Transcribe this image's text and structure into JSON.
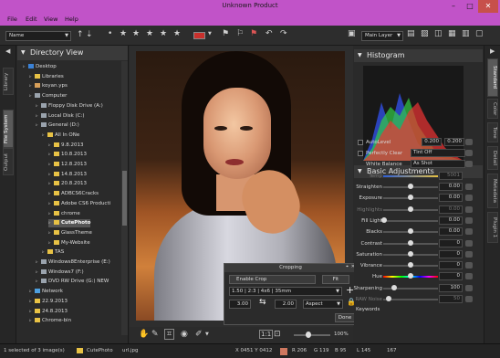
{
  "window": {
    "title": "Unknown Product"
  },
  "menu": {
    "file": "File",
    "edit": "Edit",
    "view": "View",
    "help": "Help"
  },
  "toolbar": {
    "sort": "Name",
    "layer": "Main Layer"
  },
  "left_tabs": {
    "library": "Library",
    "filesystem": "File System",
    "output": "Output"
  },
  "right_tabs": {
    "standard": "Standard",
    "color": "Color",
    "tone": "Tone",
    "detail": "Detail",
    "metadata": "Metadata",
    "plugin": "Plugin 1"
  },
  "directory": {
    "header": "Directory View",
    "items": [
      {
        "label": "Desktop"
      },
      {
        "label": "Libraries"
      },
      {
        "label": "koyan.yps"
      },
      {
        "label": "Computer"
      },
      {
        "label": "Floppy Disk Drive (A:)"
      },
      {
        "label": "Local Disk (C:)"
      },
      {
        "label": "General (D:)"
      },
      {
        "label": "All In ONe"
      },
      {
        "label": "9.8.2013"
      },
      {
        "label": "10.8.2013"
      },
      {
        "label": "12.8.2013"
      },
      {
        "label": "14.8.2013"
      },
      {
        "label": "20.8.2013"
      },
      {
        "label": "ADBCS6Cracks"
      },
      {
        "label": "Adobe CS6 Producti"
      },
      {
        "label": "chrome"
      },
      {
        "label": "CutePhoto"
      },
      {
        "label": "GlassTheme"
      },
      {
        "label": "My-Website"
      },
      {
        "label": "TAS"
      },
      {
        "label": "Windows8Enterprise (E:)"
      },
      {
        "label": "Windows7 (F:)"
      },
      {
        "label": "DVD RW Drive (G:) NEW"
      },
      {
        "label": "Network"
      },
      {
        "label": "22.9.2013"
      },
      {
        "label": "24.8.2013"
      },
      {
        "label": "Chrome-bin"
      }
    ]
  },
  "crop": {
    "title": "Cropping",
    "enable": "Enable Crop",
    "fit": "Fit",
    "ratio": "1.50 | 2:3 | 4x6 | 35mm",
    "w": "3.00",
    "h": "2.00",
    "mode": "Aspect",
    "done": "Done"
  },
  "histogram": {
    "title": "Histogram"
  },
  "adjust": {
    "title": "Basic Adjustments",
    "autolevel": {
      "label": "AutoLevel",
      "v1": "0.200",
      "v2": "0.200"
    },
    "perfectly_clear": {
      "label": "Perfectly Clear",
      "value": "Tint Off"
    },
    "white_balance": {
      "label": "White Balance",
      "value": "As Shot"
    },
    "temp": {
      "label": "Temp",
      "value": "5001"
    },
    "sliders": [
      {
        "label": "Straighten",
        "value": "0.00"
      },
      {
        "label": "Exposure",
        "value": "0.00"
      },
      {
        "label": "Highlights",
        "value": "0.00"
      },
      {
        "label": "Fill Light",
        "value": "0.00"
      },
      {
        "label": "Blacks",
        "value": "0.00"
      },
      {
        "label": "Contrast",
        "value": "0"
      },
      {
        "label": "Saturation",
        "value": "0"
      },
      {
        "label": "Vibrance",
        "value": "0"
      },
      {
        "label": "Hue",
        "value": "0"
      },
      {
        "label": "Sharpening",
        "value": "100"
      },
      {
        "label": "RAW Noise",
        "value": "50"
      }
    ],
    "keywords": "Keywords"
  },
  "bottom": {
    "zoom": "100%"
  },
  "status": {
    "selected": "1 selected of 3 image(s)",
    "folder": "CutePhoto",
    "file": "url.jpg",
    "coords": "X 0451 Y 0412",
    "r": "R 206",
    "g": "G 119",
    "b": "B 95",
    "l": "L 145",
    "v": "167"
  }
}
